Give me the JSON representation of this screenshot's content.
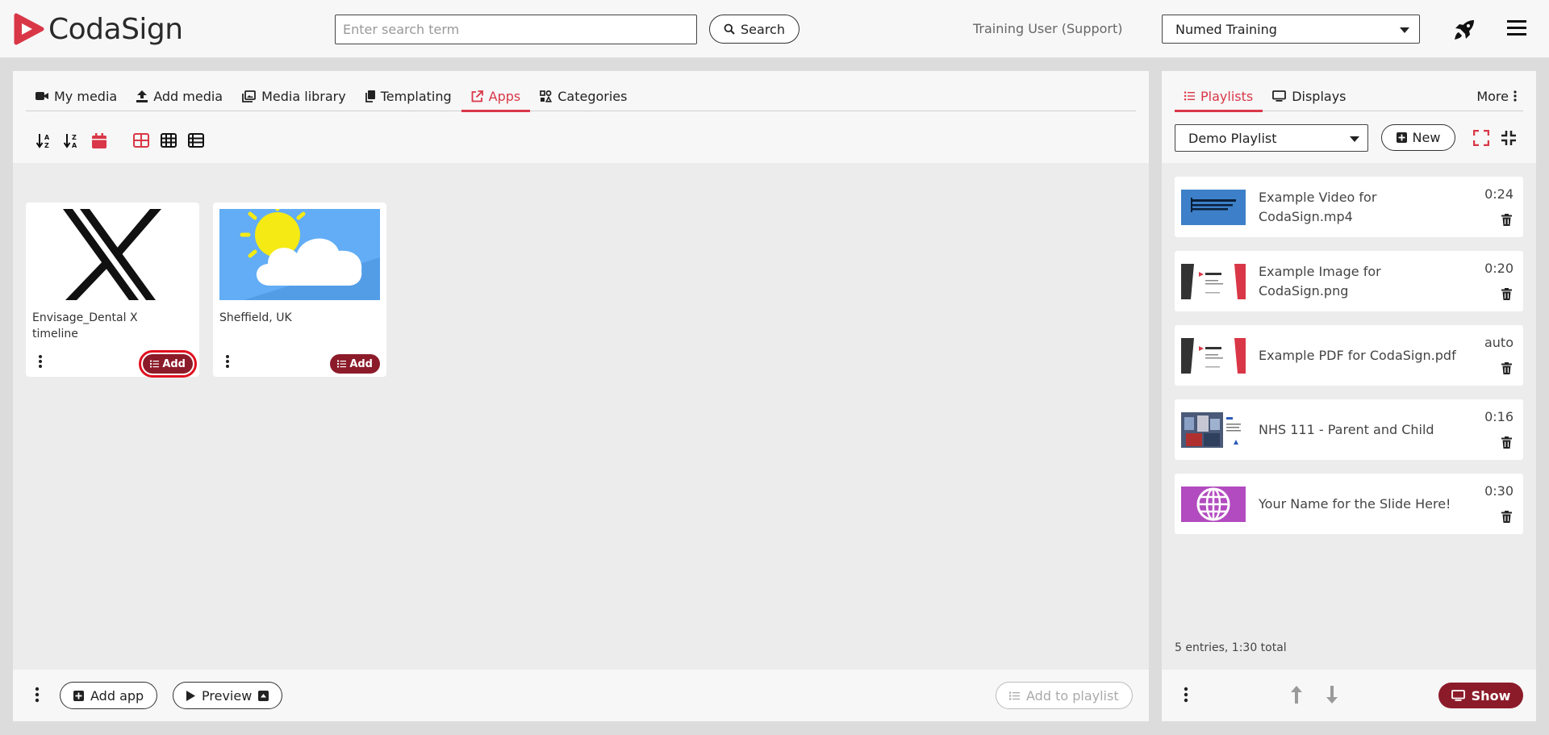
{
  "header": {
    "logo_text": "CodaSign",
    "search_placeholder": "Enter search term",
    "search_button": "Search",
    "user": "Training User (Support)",
    "organisation": "Numed Training"
  },
  "media_tabs": [
    {
      "label": "My media",
      "icon": "video-camera-icon"
    },
    {
      "label": "Add media",
      "icon": "upload-icon"
    },
    {
      "label": "Media library",
      "icon": "images-icon"
    },
    {
      "label": "Templating",
      "icon": "copy-icon"
    },
    {
      "label": "Apps",
      "icon": "external-link-icon",
      "active": true
    },
    {
      "label": "Categories",
      "icon": "categories-icon"
    }
  ],
  "apps": [
    {
      "title": "Envisage_Dental X timeline",
      "add_label": "Add",
      "thumbnail": "x-logo"
    },
    {
      "title": "Sheffield, UK",
      "add_label": "Add",
      "thumbnail": "weather-sun-cloud"
    }
  ],
  "left_footer": {
    "add_app": "Add app",
    "preview": "Preview",
    "add_to_playlist": "Add to playlist"
  },
  "playlist_tabs": [
    {
      "label": "Playlists",
      "active": true
    },
    {
      "label": "Displays"
    }
  ],
  "more_label": "More",
  "playlist": {
    "selected": "Demo Playlist",
    "new_button": "New",
    "entries": [
      {
        "title": "Example Video for CodaSign.mp4",
        "duration": "0:24"
      },
      {
        "title": "Example Image for CodaSign.png",
        "duration": "0:20"
      },
      {
        "title": "Example PDF for CodaSign.pdf",
        "duration": "auto"
      },
      {
        "title": "NHS 111 - Parent and Child",
        "duration": "0:16"
      },
      {
        "title": "Your Name for the Slide Here!",
        "duration": "0:30"
      }
    ],
    "summary": "5 entries, 1:30 total"
  },
  "right_footer": {
    "show": "Show"
  },
  "colors": {
    "accent": "#d93747",
    "brand_dark": "#8c1b2a"
  }
}
